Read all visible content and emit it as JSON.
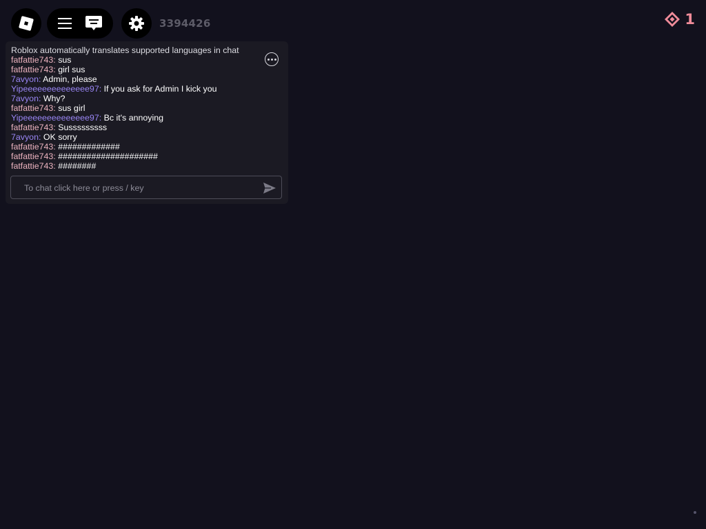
{
  "topbar": {
    "roblox_icon": "roblox-logo-icon",
    "menu_icon": "hamburger-menu-icon",
    "chat_icon": "chat-bubble-icon",
    "settings_icon": "gear-icon",
    "ping": "3394426",
    "currency_icon": "diamond-badge-icon",
    "currency_value": "1"
  },
  "chat": {
    "system_message": "Roblox automatically translates supported languages in chat",
    "more_icon": "more-options-icon",
    "messages": [
      {
        "name": "fatfattie743:",
        "text": " sus"
      },
      {
        "name": "fatfattie743:",
        "text": " girl sus"
      },
      {
        "name": "7avyon:",
        "text": " Admin, please"
      },
      {
        "name": "Yipeeeeeeeeeeeeee97:",
        "text": " If you ask for Admin I kick you"
      },
      {
        "name": "7avyon:",
        "text": " Why?"
      },
      {
        "name": "fatfattie743:",
        "text": " sus girl"
      },
      {
        "name": "Yipeeeeeeeeeeeeee97:",
        "text": " Bc it's annoying"
      },
      {
        "name": "fatfattie743:",
        "text": " Susssssssss"
      },
      {
        "name": "7avyon:",
        "text": " OK sorry"
      },
      {
        "name": "fatfattie743:",
        "text": " #############"
      },
      {
        "name": "fatfattie743:",
        "text": " #####################"
      },
      {
        "name": "fatfattie743:",
        "text": " ########"
      }
    ],
    "input_placeholder": "To chat click here or press / key",
    "send_icon": "send-arrow-icon"
  },
  "colors": {
    "background": "#12111d",
    "chat_bg": "#1b1a23",
    "name_pink": "#ecb3bf",
    "name_purple": "#9a86f5",
    "currency": "#f08c9a"
  }
}
